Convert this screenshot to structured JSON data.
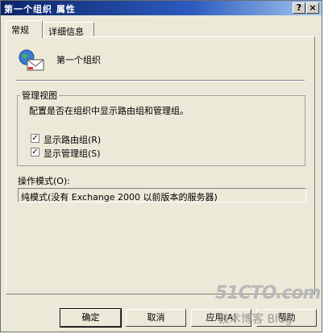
{
  "window": {
    "title": "第一个组织 属性",
    "help_button": "?",
    "close_button": "×"
  },
  "tabs": [
    {
      "label": "常规",
      "active": true
    },
    {
      "label": "详细信息",
      "active": false
    }
  ],
  "general": {
    "icon": "organization-mail-icon",
    "org_name": "第一个组织",
    "admin_view": {
      "group_label": "管理视图",
      "description": "配置是否在组织中显示路由组和管理组。",
      "show_routing_groups": {
        "label": "显示路由组(R)",
        "checked": true
      },
      "show_admin_groups": {
        "label": "显示管理组(S)",
        "checked": true
      }
    },
    "operation_mode": {
      "label": "操作模式(O):",
      "value": "纯模式(没有 Exchange 2000 以前版本的服务器)"
    }
  },
  "buttons": {
    "ok": "确定",
    "cancel": "取消",
    "apply": "应用(A)",
    "help": "帮助"
  },
  "watermark": {
    "site": "51CTO.com",
    "caption": "技术博客 Blog"
  },
  "colors": {
    "titlebar": "#0a246a",
    "face": "#ece9d8"
  }
}
